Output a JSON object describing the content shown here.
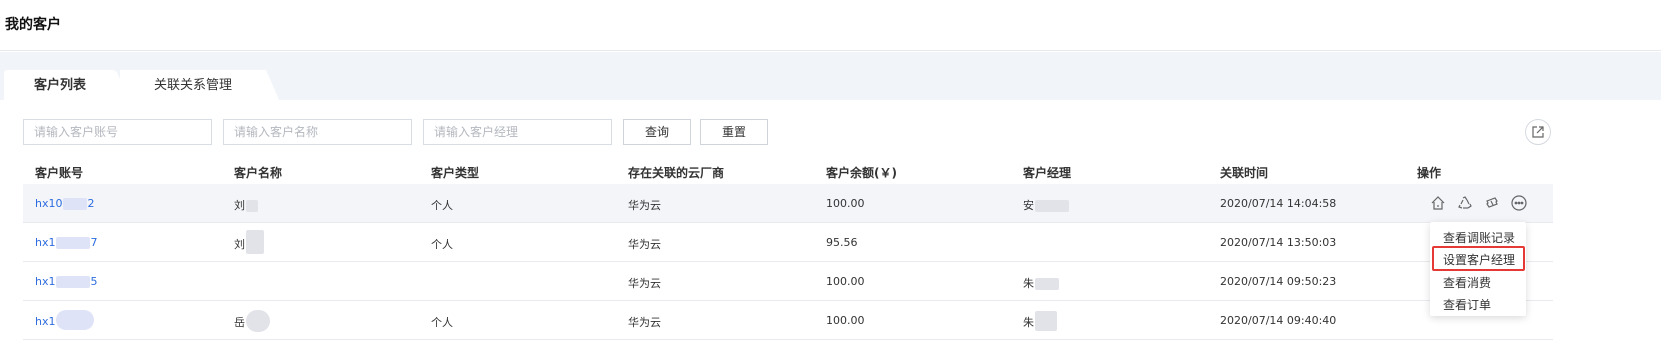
{
  "page": {
    "title": "我的客户"
  },
  "tabs": [
    {
      "label": "客户列表",
      "active": true
    },
    {
      "label": "关联关系管理",
      "active": false
    }
  ],
  "filters": {
    "account_placeholder": "请输入客户账号",
    "name_placeholder": "请输入客户名称",
    "manager_placeholder": "请输入客户经理",
    "query_label": "查询",
    "reset_label": "重置"
  },
  "table": {
    "headers": [
      "客户账号",
      "客户名称",
      "客户类型",
      "存在关联的云厂商",
      "客户余额(￥)",
      "客户经理",
      "关联时间",
      "操作"
    ],
    "rows": [
      {
        "account": "hx10",
        "account_tail": "2",
        "name": "刘",
        "type": "个人",
        "cloud": "华为云",
        "balance": "100.00",
        "manager": "安",
        "time": "2020/07/14 14:04:58"
      },
      {
        "account": "hx1",
        "account_tail": "7",
        "name": "刘",
        "type": "个人",
        "cloud": "华为云",
        "balance": "95.56",
        "manager": "",
        "time": "2020/07/14 13:50:03"
      },
      {
        "account": "hx1",
        "account_tail": "5",
        "name": "",
        "type": "",
        "cloud": "华为云",
        "balance": "100.00",
        "manager": "朱",
        "time": "2020/07/14 09:50:23"
      },
      {
        "account": "hx1",
        "account_tail": "",
        "name": "岳",
        "type": "个人",
        "cloud": "华为云",
        "balance": "100.00",
        "manager": "朱",
        "time": "2020/07/14 09:40:40"
      }
    ]
  },
  "dropdown": {
    "items": [
      "查看调账记录",
      "设置客户经理",
      "查看消费",
      "查看订单"
    ],
    "highlighted": "设置客户经理"
  },
  "colors": {
    "link": "#2d6ce0",
    "highlight": "#e53935",
    "background": "#f1f4f9"
  },
  "icons": [
    "home-icon",
    "recycle-icon",
    "ticket-icon",
    "more-icon",
    "export-icon"
  ]
}
